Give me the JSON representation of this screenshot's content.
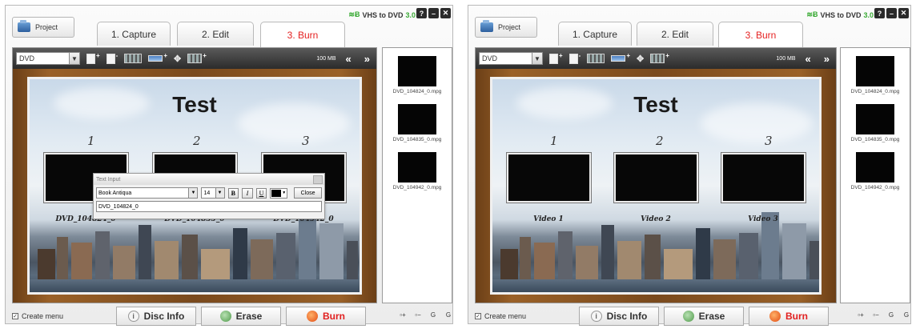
{
  "app": {
    "project_label": "Project",
    "tabs": [
      "1. Capture",
      "2. Edit",
      "3. Burn"
    ],
    "brand": "VHS to DVD",
    "version": "3.0",
    "brand_mark": "≋Ƀ",
    "window_buttons": [
      "?",
      "–",
      "✕"
    ]
  },
  "toolbar": {
    "disc_type": "DVD",
    "size": "100 MB",
    "nav_prev": "«",
    "nav_next": "»"
  },
  "bottom": {
    "create_menu": "Create menu",
    "disc_info": "Disc Info",
    "erase": "Erase",
    "burn": "Burn",
    "icons": [
      "add-page-icon",
      "remove-page-icon",
      "ipod-icon",
      "psp-icon"
    ]
  },
  "files": [
    "DVD_104824_0.mpg",
    "DVD_104835_0.mpg",
    "DVD_104942_0.mpg"
  ],
  "left": {
    "menu_title": "Test",
    "numbers": [
      "1",
      "2",
      "3"
    ],
    "captions": [
      "DVD_104824_0",
      "DVD_104835_0",
      "DVD_104942_0"
    ],
    "dialog": {
      "title": "Text Input",
      "font": "Book Antiqua",
      "size": "14",
      "bold": "B",
      "italic": "I",
      "underline": "U",
      "close": "Close",
      "value": "DVD_104824_0"
    }
  },
  "right": {
    "menu_title": "Test",
    "numbers": [
      "1",
      "2",
      "3"
    ],
    "captions": [
      "Video 1",
      "Video 2",
      "Video 3"
    ]
  }
}
